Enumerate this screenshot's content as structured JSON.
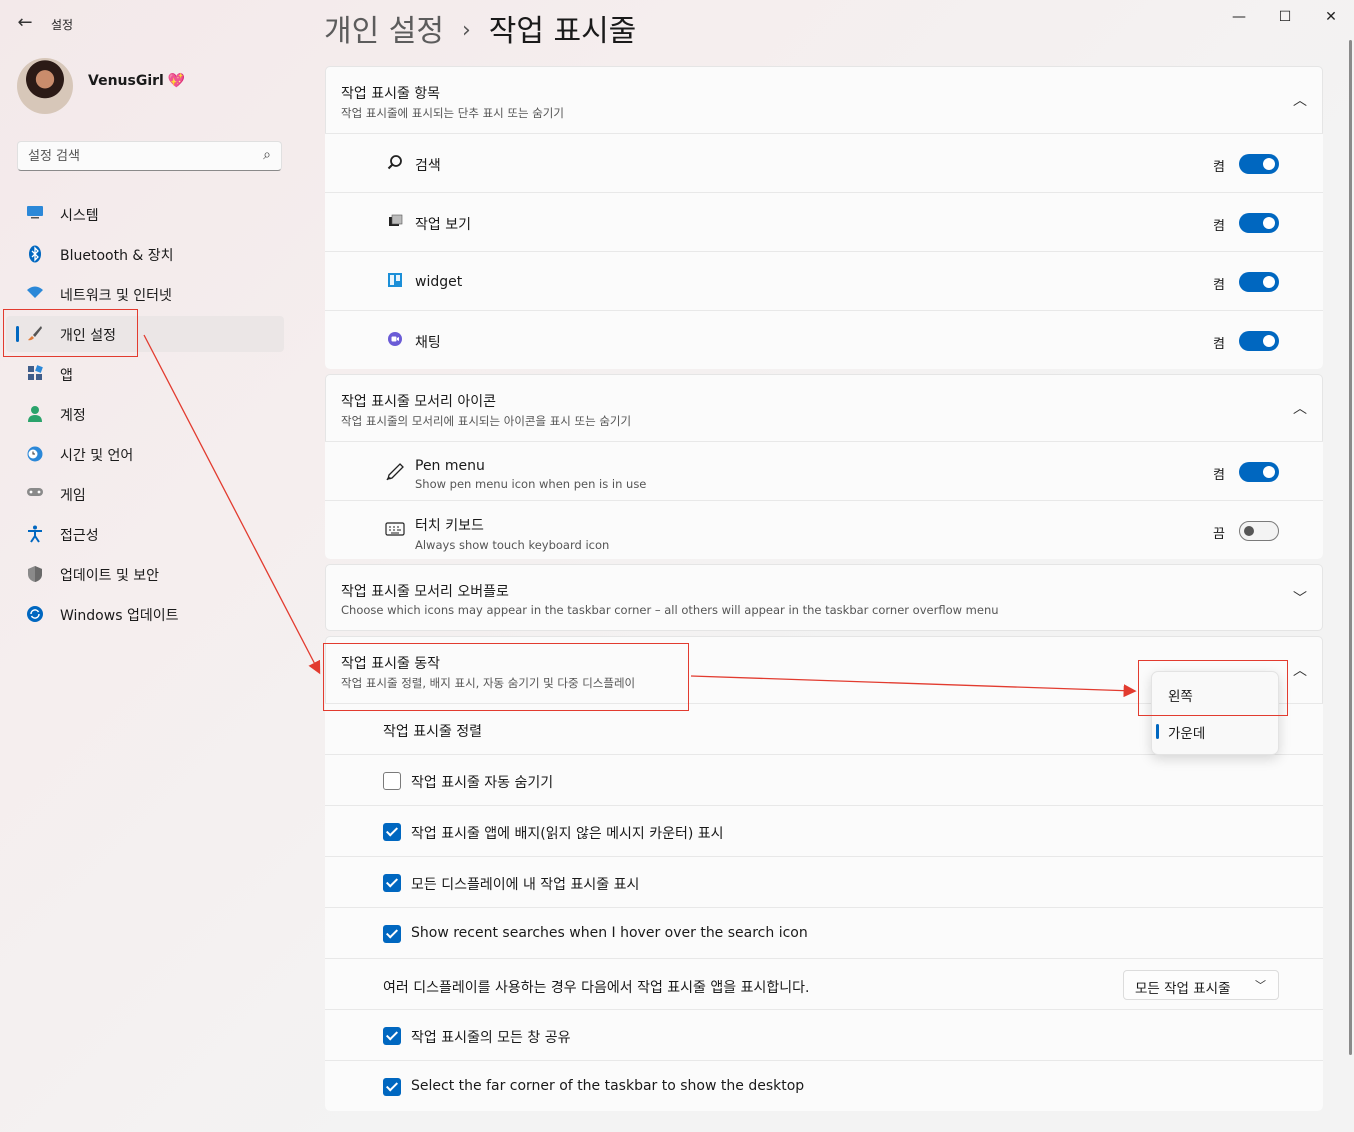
{
  "window": {
    "title": "설정",
    "controls": [
      "—",
      "☐",
      "✕"
    ]
  },
  "profile": {
    "name": "VenusGirl",
    "emoji": "💖"
  },
  "search": {
    "placeholder": "설정 검색"
  },
  "sidebar": {
    "items": [
      {
        "label": "시스템",
        "icon": "monitor-icon",
        "color": "#0067c0"
      },
      {
        "label": "Bluetooth & 장치",
        "icon": "bluetooth-icon",
        "color": "#0067c0"
      },
      {
        "label": "네트워크 및 인터넷",
        "icon": "wifi-icon",
        "color": "#0067c0"
      },
      {
        "label": "개인 설정",
        "icon": "brush-icon",
        "selected": true,
        "color": "#e07b39"
      },
      {
        "label": "앱",
        "icon": "apps-icon",
        "color": "#3f5d8a"
      },
      {
        "label": "계정",
        "icon": "account-icon",
        "color": "#2aa36b"
      },
      {
        "label": "시간 및 언어",
        "icon": "clock-globe-icon",
        "color": "#0067c0"
      },
      {
        "label": "게임",
        "icon": "gamepad-icon",
        "color": "#777777"
      },
      {
        "label": "접근성",
        "icon": "accessibility-icon",
        "color": "#0067c0"
      },
      {
        "label": "업데이트 및 보안",
        "icon": "shield-icon",
        "color": "#777777"
      },
      {
        "label": "Windows 업데이트",
        "icon": "refresh-icon",
        "color": "#0067c0"
      }
    ]
  },
  "header": {
    "parent": "개인 설정",
    "separator": "›",
    "current": "작업 표시줄"
  },
  "taskbar_items": {
    "title": "작업 표시줄 항목",
    "subtitle": "작업 표시줄에 표시되는 단추 표시 또는 숨기기",
    "rows": [
      {
        "label": "검색",
        "state": "켬",
        "on": true,
        "icon": "search-icon"
      },
      {
        "label": "작업 보기",
        "state": "켬",
        "on": true,
        "icon": "task-view-icon"
      },
      {
        "label": "widget",
        "state": "켬",
        "on": true,
        "icon": "widgets-icon"
      },
      {
        "label": "채팅",
        "state": "켬",
        "on": true,
        "icon": "chat-icon"
      }
    ]
  },
  "corner_icons": {
    "title": "작업 표시줄 모서리 아이콘",
    "subtitle": "작업 표시줄의 모서리에 표시되는 아이콘을 표시 또는 숨기기",
    "rows": [
      {
        "label": "Pen menu",
        "sub": "Show pen menu icon when pen is in use",
        "state": "켬",
        "on": true,
        "icon": "pen-icon"
      },
      {
        "label": "터치 키보드",
        "sub": "Always show touch keyboard icon",
        "state": "끔",
        "on": false,
        "icon": "keyboard-icon"
      }
    ]
  },
  "overflow": {
    "title": "작업 표시줄 모서리 오버플로",
    "subtitle": "Choose which icons may appear in the taskbar corner – all others will appear in the taskbar corner overflow menu"
  },
  "behaviors": {
    "title": "작업 표시줄 동작",
    "subtitle": "작업 표시줄 정렬, 배지 표시, 자동 숨기기 및 다중 디스플레이",
    "alignment_label": "작업 표시줄 정렬",
    "alignment_options": [
      "왼쪽",
      "가운데"
    ],
    "alignment_selected": "가운데",
    "checks": [
      {
        "label": "작업 표시줄 자동 숨기기",
        "checked": false
      },
      {
        "label": "작업 표시줄 앱에 배지(읽지 않은 메시지 카운터) 표시",
        "checked": true
      },
      {
        "label": "모든 디스플레이에 내 작업 표시줄 표시",
        "checked": true
      },
      {
        "label": "Show recent searches when I hover over the search icon",
        "checked": true
      }
    ],
    "multi_display_label": "여러 디스플레이를 사용하는 경우 다음에서 작업 표시줄 앱을 표시합니다.",
    "multi_display_value": "모든 작업 표시줄",
    "checks2": [
      {
        "label": "작업 표시줄의 모든 창 공유",
        "checked": true
      },
      {
        "label": "Select the far corner of the taskbar to show the desktop",
        "checked": true
      }
    ]
  },
  "colors": {
    "accent": "#0067c0",
    "annotation": "#e23b2f"
  }
}
